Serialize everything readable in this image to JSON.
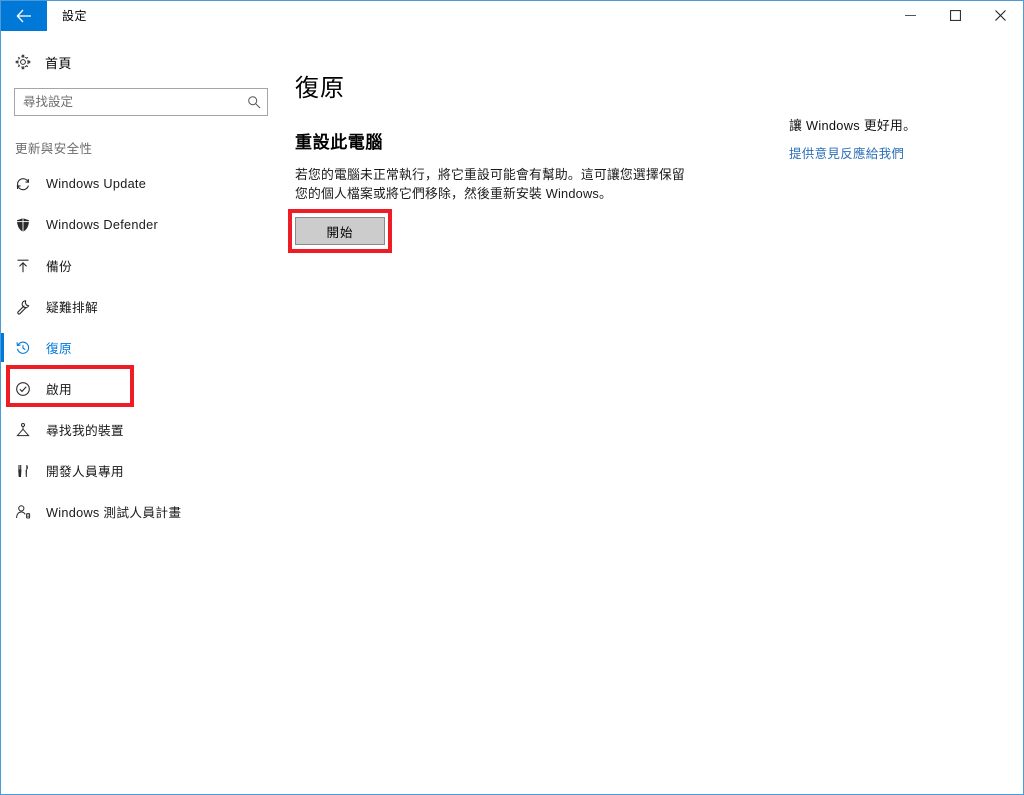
{
  "window": {
    "title": "設定",
    "back_icon": "back-arrow-icon",
    "controls": {
      "minimize": "minimize-icon",
      "maximize": "maximize-icon",
      "close": "close-icon"
    },
    "border_color": "#4a9bd8",
    "accent_color": "#0078d7"
  },
  "sidebar": {
    "home": {
      "label": "首頁",
      "icon": "gear-icon"
    },
    "search": {
      "placeholder": "尋找設定",
      "value": "",
      "icon": "search-icon"
    },
    "group_header": "更新與安全性",
    "items": [
      {
        "label": "Windows Update",
        "icon": "refresh-icon",
        "selected": false
      },
      {
        "label": "Windows Defender",
        "icon": "shield-icon",
        "selected": false
      },
      {
        "label": "備份",
        "icon": "upload-arrow-icon",
        "selected": false
      },
      {
        "label": "疑難排解",
        "icon": "wrench-icon",
        "selected": false
      },
      {
        "label": "復原",
        "icon": "history-clock-icon",
        "selected": true
      },
      {
        "label": "啟用",
        "icon": "check-circle-icon",
        "selected": false
      },
      {
        "label": "尋找我的裝置",
        "icon": "find-device-icon",
        "selected": false
      },
      {
        "label": "開發人員專用",
        "icon": "tools-icon",
        "selected": false
      },
      {
        "label": "Windows 測試人員計畫",
        "icon": "person-insider-icon",
        "selected": false
      }
    ]
  },
  "main": {
    "page_title": "復原",
    "section_title": "重設此電腦",
    "section_description": "若您的電腦未正常執行，將它重設可能會有幫助。這可讓您選擇保留您的個人檔案或將它們移除，然後重新安裝 Windows。",
    "start_button": "開始"
  },
  "aside": {
    "title": "讓 Windows 更好用。",
    "link": "提供意見反應給我們"
  },
  "annotations": {
    "highlight_color": "#ee1c25",
    "boxes": [
      {
        "name": "recovery-nav-highlight"
      },
      {
        "name": "start-button-highlight"
      }
    ]
  }
}
